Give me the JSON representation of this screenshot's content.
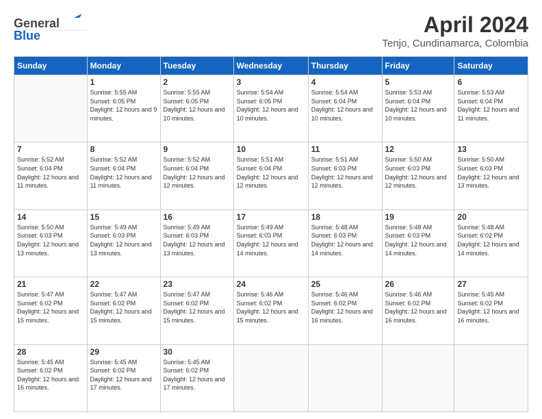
{
  "header": {
    "logo_general": "General",
    "logo_blue": "Blue",
    "month_title": "April 2024",
    "subtitle": "Tenjo, Cundinamarca, Colombia"
  },
  "weekdays": [
    "Sunday",
    "Monday",
    "Tuesday",
    "Wednesday",
    "Thursday",
    "Friday",
    "Saturday"
  ],
  "weeks": [
    [
      {
        "day": "",
        "info": ""
      },
      {
        "day": "1",
        "info": "Sunrise: 5:55 AM\nSunset: 6:05 PM\nDaylight: 12 hours\nand 9 minutes."
      },
      {
        "day": "2",
        "info": "Sunrise: 5:55 AM\nSunset: 6:05 PM\nDaylight: 12 hours\nand 10 minutes."
      },
      {
        "day": "3",
        "info": "Sunrise: 5:54 AM\nSunset: 6:05 PM\nDaylight: 12 hours\nand 10 minutes."
      },
      {
        "day": "4",
        "info": "Sunrise: 5:54 AM\nSunset: 6:04 PM\nDaylight: 12 hours\nand 10 minutes."
      },
      {
        "day": "5",
        "info": "Sunrise: 5:53 AM\nSunset: 6:04 PM\nDaylight: 12 hours\nand 10 minutes."
      },
      {
        "day": "6",
        "info": "Sunrise: 5:53 AM\nSunset: 6:04 PM\nDaylight: 12 hours\nand 11 minutes."
      }
    ],
    [
      {
        "day": "7",
        "info": ""
      },
      {
        "day": "8",
        "info": "Sunrise: 5:52 AM\nSunset: 6:04 PM\nDaylight: 12 hours\nand 11 minutes."
      },
      {
        "day": "9",
        "info": "Sunrise: 5:52 AM\nSunset: 6:04 PM\nDaylight: 12 hours\nand 12 minutes."
      },
      {
        "day": "10",
        "info": "Sunrise: 5:51 AM\nSunset: 6:04 PM\nDaylight: 12 hours\nand 12 minutes."
      },
      {
        "day": "11",
        "info": "Sunrise: 5:51 AM\nSunset: 6:03 PM\nDaylight: 12 hours\nand 12 minutes."
      },
      {
        "day": "12",
        "info": "Sunrise: 5:50 AM\nSunset: 6:03 PM\nDaylight: 12 hours\nand 12 minutes."
      },
      {
        "day": "13",
        "info": "Sunrise: 5:50 AM\nSunset: 6:03 PM\nDaylight: 12 hours\nand 13 minutes."
      }
    ],
    [
      {
        "day": "14",
        "info": ""
      },
      {
        "day": "15",
        "info": "Sunrise: 5:49 AM\nSunset: 6:03 PM\nDaylight: 12 hours\nand 13 minutes."
      },
      {
        "day": "16",
        "info": "Sunrise: 5:49 AM\nSunset: 6:03 PM\nDaylight: 12 hours\nand 13 minutes."
      },
      {
        "day": "17",
        "info": "Sunrise: 5:49 AM\nSunset: 6:03 PM\nDaylight: 12 hours\nand 14 minutes."
      },
      {
        "day": "18",
        "info": "Sunrise: 5:48 AM\nSunset: 6:03 PM\nDaylight: 12 hours\nand 14 minutes."
      },
      {
        "day": "19",
        "info": "Sunrise: 5:48 AM\nSunset: 6:03 PM\nDaylight: 12 hours\nand 14 minutes."
      },
      {
        "day": "20",
        "info": "Sunrise: 5:48 AM\nSunset: 6:02 PM\nDaylight: 12 hours\nand 14 minutes."
      }
    ],
    [
      {
        "day": "21",
        "info": ""
      },
      {
        "day": "22",
        "info": "Sunrise: 5:47 AM\nSunset: 6:02 PM\nDaylight: 12 hours\nand 15 minutes."
      },
      {
        "day": "23",
        "info": "Sunrise: 5:47 AM\nSunset: 6:02 PM\nDaylight: 12 hours\nand 15 minutes."
      },
      {
        "day": "24",
        "info": "Sunrise: 5:46 AM\nSunset: 6:02 PM\nDaylight: 12 hours\nand 15 minutes."
      },
      {
        "day": "25",
        "info": "Sunrise: 5:46 AM\nSunset: 6:02 PM\nDaylight: 12 hours\nand 16 minutes."
      },
      {
        "day": "26",
        "info": "Sunrise: 5:46 AM\nSunset: 6:02 PM\nDaylight: 12 hours\nand 16 minutes."
      },
      {
        "day": "27",
        "info": "Sunrise: 5:45 AM\nSunset: 6:02 PM\nDaylight: 12 hours\nand 16 minutes."
      }
    ],
    [
      {
        "day": "28",
        "info": "Sunrise: 5:45 AM\nSunset: 6:02 PM\nDaylight: 12 hours\nand 16 minutes."
      },
      {
        "day": "29",
        "info": "Sunrise: 5:45 AM\nSunset: 6:02 PM\nDaylight: 12 hours\nand 17 minutes."
      },
      {
        "day": "30",
        "info": "Sunrise: 5:45 AM\nSunset: 6:02 PM\nDaylight: 12 hours\nand 17 minutes."
      },
      {
        "day": "",
        "info": ""
      },
      {
        "day": "",
        "info": ""
      },
      {
        "day": "",
        "info": ""
      },
      {
        "day": "",
        "info": ""
      }
    ]
  ],
  "week7_sunday": "Sunrise: 5:52 AM\nSunset: 6:04 PM\nDaylight: 12 hours\nand 11 minutes.",
  "week14_sunday": "Sunrise: 5:50 AM\nSunset: 6:03 PM\nDaylight: 12 hours\nand 13 minutes.",
  "week21_sunday": "Sunrise: 5:47 AM\nSunset: 6:02 PM\nDaylight: 12 hours\nand 15 minutes."
}
